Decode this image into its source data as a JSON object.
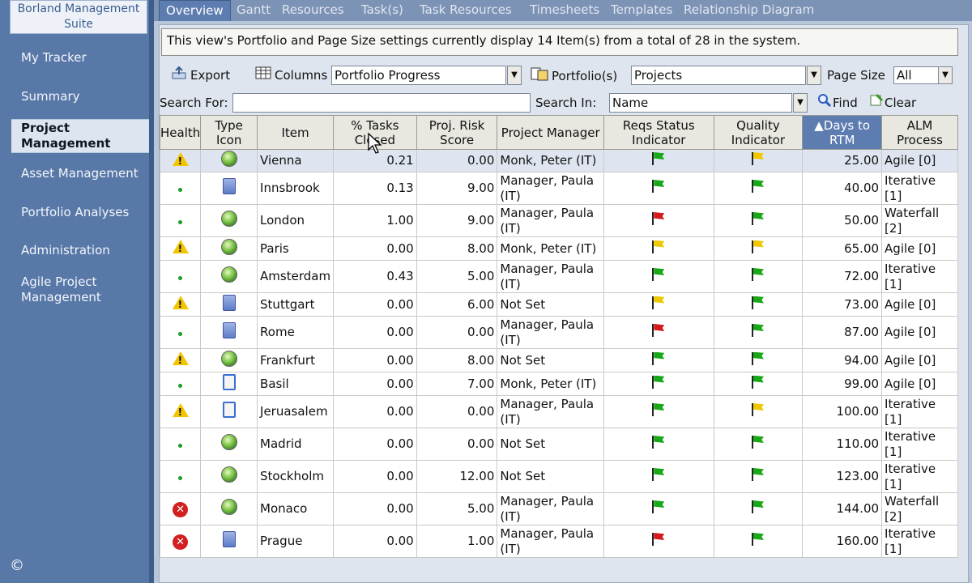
{
  "sidebar": {
    "brand": "Borland Management Suite",
    "items": [
      "My Tracker",
      "Summary",
      "Project Management",
      "Asset Management",
      "Portfolio Analyses",
      "Administration",
      "Agile Project Management"
    ],
    "active_index": 2
  },
  "copyright": "©",
  "tabs": [
    "Overview",
    "Gantt",
    "Resources",
    "Task(s)",
    "Task Resources",
    "Timesheets",
    "Templates",
    "Relationship Diagram"
  ],
  "info_message": "This view's Portfolio and Page Size settings currently display 14 Item(s) from a total of 28 in the system.",
  "toolbar": {
    "export_label": "Export",
    "columns_label": "Columns",
    "view_value": "Portfolio Progress",
    "portfolios_label": "Portfolio(s)",
    "portfolio_value": "Projects",
    "page_size_label": "Page Size",
    "page_size_value": "All",
    "search_for_label": "Search For:",
    "search_for_value": "",
    "search_in_label": "Search In:",
    "search_in_value": "Name",
    "find_label": "Find",
    "clear_label": "Clear"
  },
  "grid": {
    "columns": [
      "Health",
      "Type Icon",
      "Item",
      "% Tasks Closed",
      "Proj. Risk Score",
      "Project Manager",
      "Reqs Status Indicator",
      "Quality Indicator",
      "Days to RTM",
      "ALM Process"
    ],
    "sorted_column": 8,
    "rows": [
      {
        "health": "warning",
        "type": "globe",
        "item": "Vienna",
        "pct": "0.21",
        "risk": "0.00",
        "pm": "Monk, Peter (IT)",
        "reqs": "green",
        "quality": "yellow",
        "days": "25.00",
        "alm": "Agile [0]"
      },
      {
        "health": "ok",
        "type": "server",
        "item": "Innsbrook",
        "pct": "0.13",
        "risk": "9.00",
        "pm": "Manager, Paula (IT)",
        "reqs": "green",
        "quality": "green",
        "days": "40.00",
        "alm": "Iterative [1]"
      },
      {
        "health": "ok",
        "type": "globe",
        "item": "London",
        "pct": "1.00",
        "risk": "9.00",
        "pm": "Manager, Paula (IT)",
        "reqs": "red",
        "quality": "green",
        "days": "50.00",
        "alm": "Waterfall [2]"
      },
      {
        "health": "warning",
        "type": "globe",
        "item": "Paris",
        "pct": "0.00",
        "risk": "8.00",
        "pm": "Monk, Peter (IT)",
        "reqs": "yellow",
        "quality": "yellow",
        "days": "65.00",
        "alm": "Agile [0]"
      },
      {
        "health": "ok",
        "type": "globe",
        "item": "Amsterdam",
        "pct": "0.43",
        "risk": "5.00",
        "pm": "Manager, Paula (IT)",
        "reqs": "green",
        "quality": "green",
        "days": "72.00",
        "alm": "Iterative [1]"
      },
      {
        "health": "warning",
        "type": "server",
        "item": "Stuttgart",
        "pct": "0.00",
        "risk": "6.00",
        "pm": "Not Set",
        "reqs": "yellow",
        "quality": "green",
        "days": "73.00",
        "alm": "Agile [0]"
      },
      {
        "health": "ok",
        "type": "server",
        "item": "Rome",
        "pct": "0.00",
        "risk": "0.00",
        "pm": "Manager, Paula (IT)",
        "reqs": "red",
        "quality": "green",
        "days": "87.00",
        "alm": "Agile [0]"
      },
      {
        "health": "warning",
        "type": "globe",
        "item": "Frankfurt",
        "pct": "0.00",
        "risk": "8.00",
        "pm": "Not Set",
        "reqs": "green",
        "quality": "green",
        "days": "94.00",
        "alm": "Agile [0]"
      },
      {
        "health": "ok",
        "type": "phone",
        "item": "Basil",
        "pct": "0.00",
        "risk": "7.00",
        "pm": "Monk, Peter (IT)",
        "reqs": "green",
        "quality": "green",
        "days": "99.00",
        "alm": "Agile [0]"
      },
      {
        "health": "warning",
        "type": "phone",
        "item": "Jeruasalem",
        "pct": "0.00",
        "risk": "0.00",
        "pm": "Manager, Paula (IT)",
        "reqs": "green",
        "quality": "yellow",
        "days": "100.00",
        "alm": "Iterative [1]"
      },
      {
        "health": "ok",
        "type": "globe",
        "item": "Madrid",
        "pct": "0.00",
        "risk": "0.00",
        "pm": "Not Set",
        "reqs": "green",
        "quality": "green",
        "days": "110.00",
        "alm": "Iterative [1]"
      },
      {
        "health": "ok",
        "type": "globe",
        "item": "Stockholm",
        "pct": "0.00",
        "risk": "12.00",
        "pm": "Not Set",
        "reqs": "green",
        "quality": "green",
        "days": "123.00",
        "alm": "Iterative [1]"
      },
      {
        "health": "error",
        "type": "globe",
        "item": "Monaco",
        "pct": "0.00",
        "risk": "5.00",
        "pm": "Manager, Paula (IT)",
        "reqs": "green",
        "quality": "green",
        "days": "144.00",
        "alm": "Waterfall [2]"
      },
      {
        "health": "error",
        "type": "server",
        "item": "Prague",
        "pct": "0.00",
        "risk": "1.00",
        "pm": "Manager, Paula (IT)",
        "reqs": "red",
        "quality": "green",
        "days": "160.00",
        "alm": "Iterative [1]"
      }
    ]
  },
  "colors": {
    "flag_green": "#18a818",
    "flag_red": "#d41a1a",
    "flag_yellow": "#f0c800",
    "sidebar_bg": "#5878a8",
    "sorted_header_bg": "#5d7cb0"
  }
}
